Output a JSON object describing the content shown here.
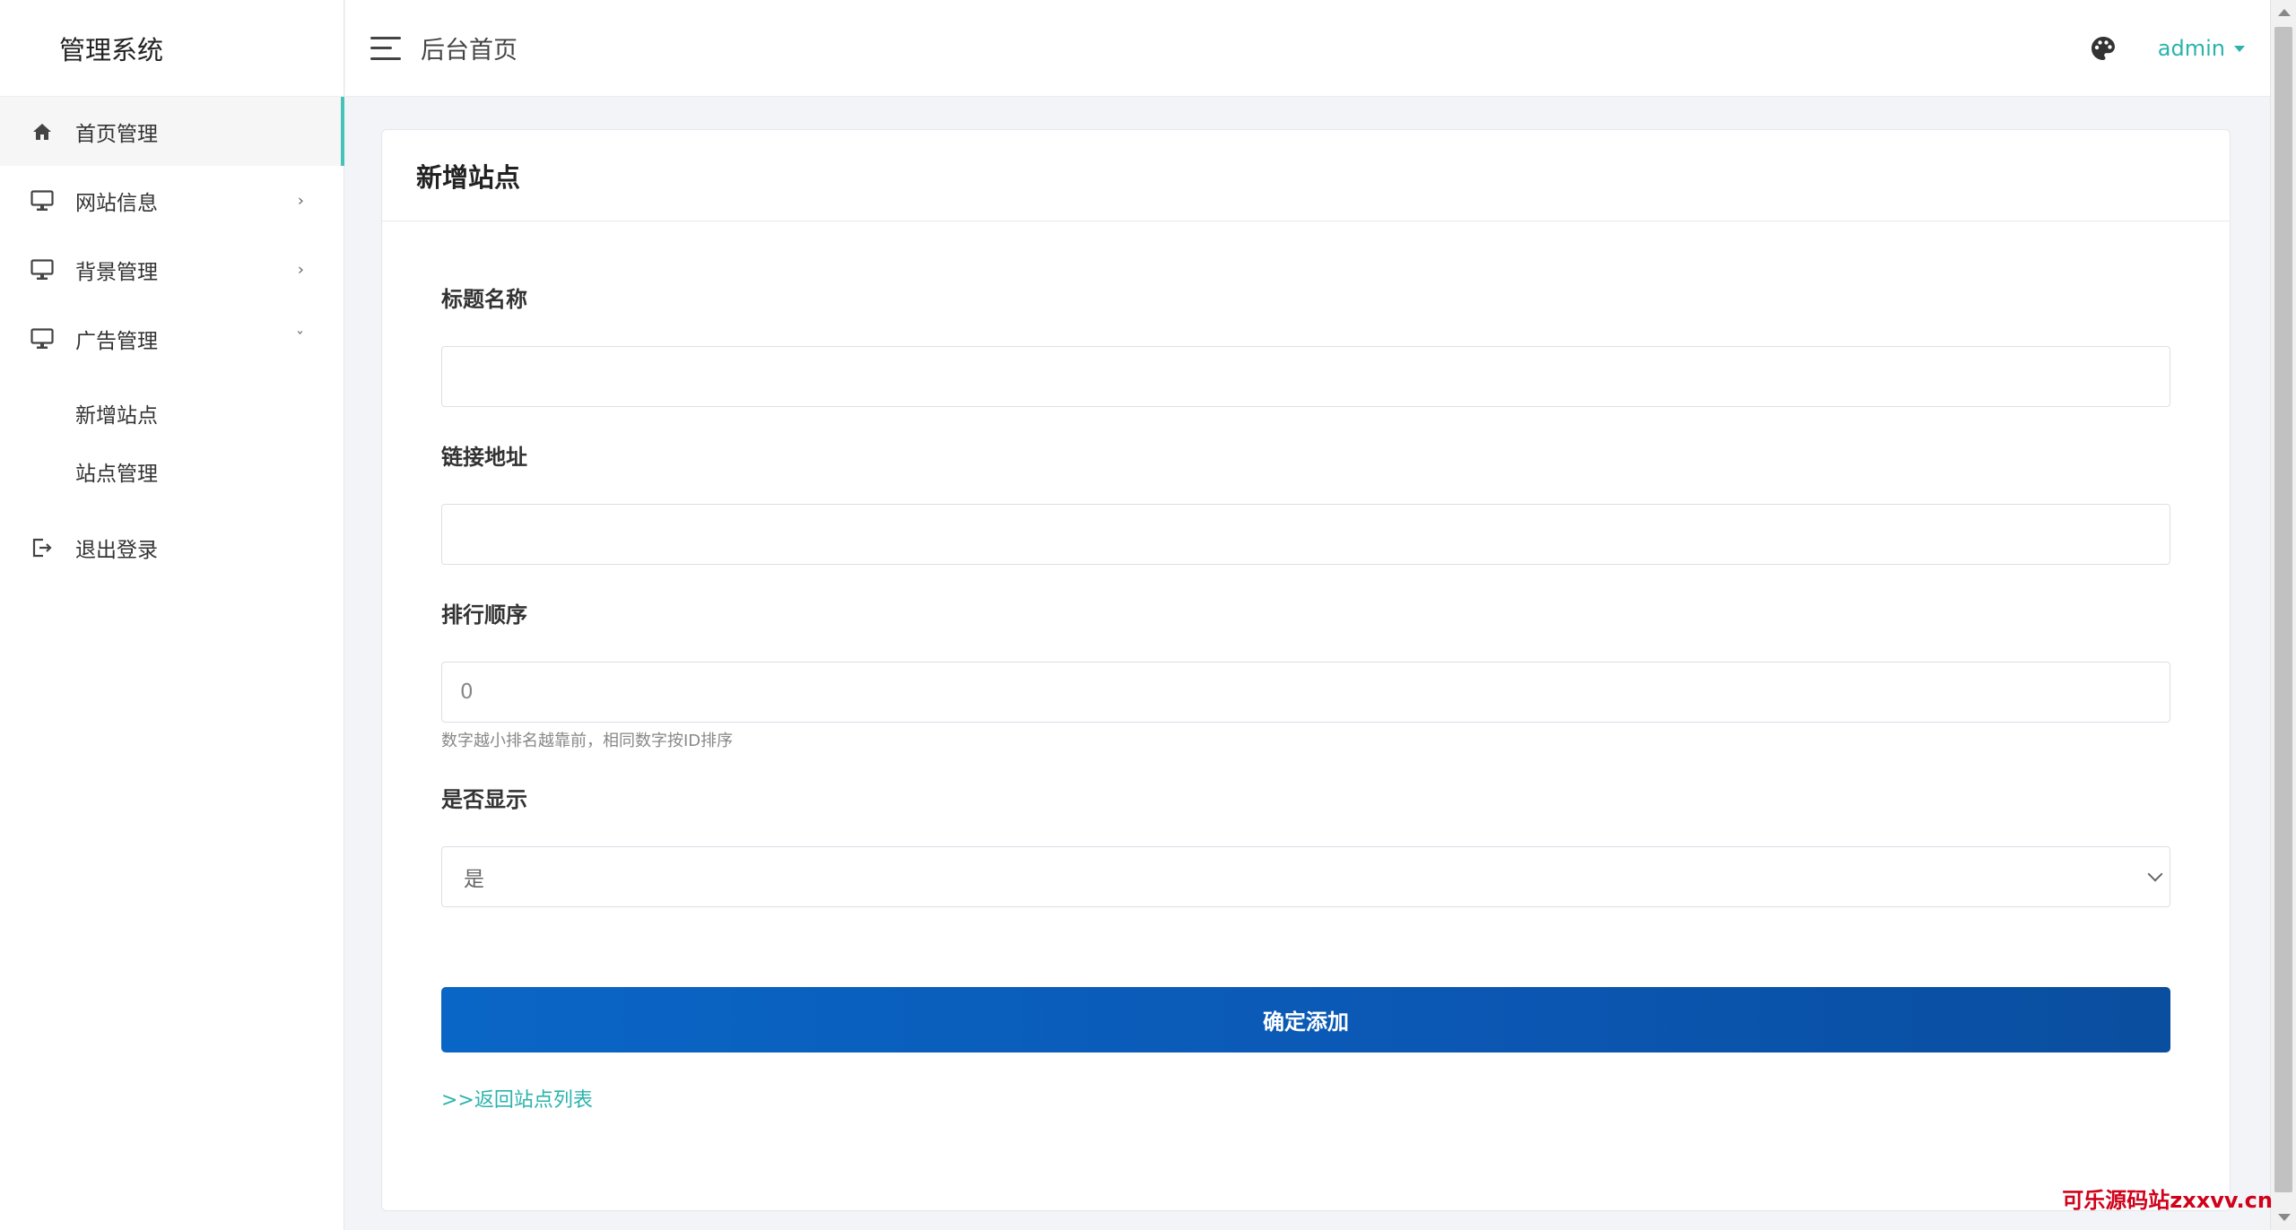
{
  "app": {
    "brand": "管理系统"
  },
  "sidebar": {
    "items": [
      {
        "label": "首页管理",
        "icon": "home-icon",
        "active": true
      },
      {
        "label": "网站信息",
        "icon": "monitor-icon",
        "chevron": "›"
      },
      {
        "label": "背景管理",
        "icon": "monitor-icon",
        "chevron": "›"
      },
      {
        "label": "广告管理",
        "icon": "monitor-icon",
        "chevron": "ˇ",
        "expanded": true
      }
    ],
    "submenu": [
      {
        "label": "新增站点"
      },
      {
        "label": "站点管理"
      }
    ],
    "logout": {
      "label": "退出登录",
      "icon": "logout-icon"
    }
  },
  "topbar": {
    "breadcrumb": "后台首页",
    "user": "admin",
    "accent_color": "#2bb3ad"
  },
  "card": {
    "title": "新增站点"
  },
  "form": {
    "title_field": {
      "label": "标题名称",
      "value": "",
      "placeholder": ""
    },
    "link_field": {
      "label": "链接地址",
      "value": "",
      "placeholder": ""
    },
    "order_field": {
      "label": "排行顺序",
      "value": "",
      "placeholder": "0",
      "help": "数字越小排名越靠前，相同数字按ID排序"
    },
    "display_field": {
      "label": "是否显示",
      "selected": "是"
    },
    "submit_label": "确定添加",
    "back_link": ">>返回站点列表",
    "button_color": "#0a5fbe"
  },
  "watermark": "可乐源码站zxxvv.cn"
}
